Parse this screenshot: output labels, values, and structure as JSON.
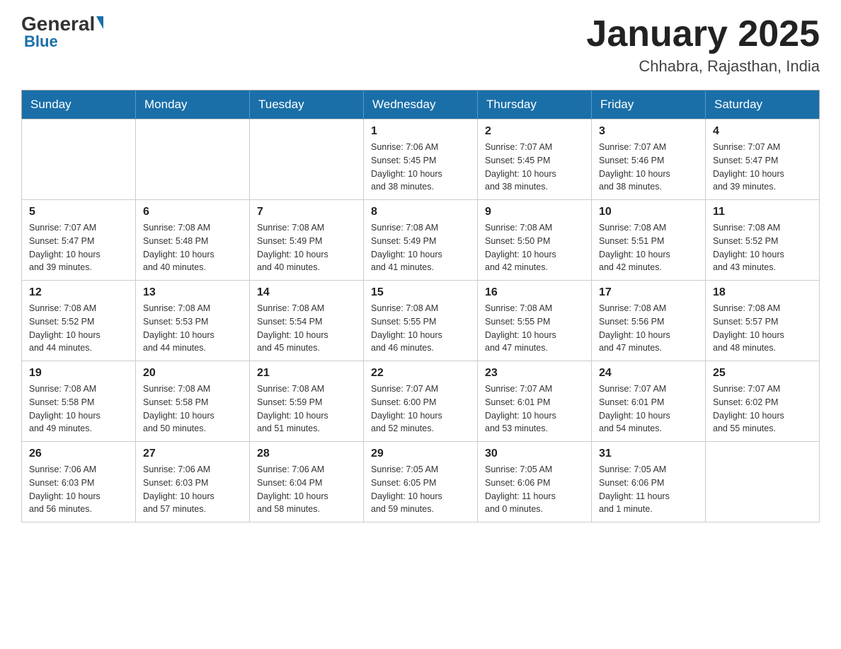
{
  "header": {
    "logo_general": "General",
    "logo_blue": "Blue",
    "title": "January 2025",
    "location": "Chhabra, Rajasthan, India"
  },
  "days_of_week": [
    "Sunday",
    "Monday",
    "Tuesday",
    "Wednesday",
    "Thursday",
    "Friday",
    "Saturday"
  ],
  "weeks": [
    [
      {
        "day": "",
        "info": ""
      },
      {
        "day": "",
        "info": ""
      },
      {
        "day": "",
        "info": ""
      },
      {
        "day": "1",
        "info": "Sunrise: 7:06 AM\nSunset: 5:45 PM\nDaylight: 10 hours\nand 38 minutes."
      },
      {
        "day": "2",
        "info": "Sunrise: 7:07 AM\nSunset: 5:45 PM\nDaylight: 10 hours\nand 38 minutes."
      },
      {
        "day": "3",
        "info": "Sunrise: 7:07 AM\nSunset: 5:46 PM\nDaylight: 10 hours\nand 38 minutes."
      },
      {
        "day": "4",
        "info": "Sunrise: 7:07 AM\nSunset: 5:47 PM\nDaylight: 10 hours\nand 39 minutes."
      }
    ],
    [
      {
        "day": "5",
        "info": "Sunrise: 7:07 AM\nSunset: 5:47 PM\nDaylight: 10 hours\nand 39 minutes."
      },
      {
        "day": "6",
        "info": "Sunrise: 7:08 AM\nSunset: 5:48 PM\nDaylight: 10 hours\nand 40 minutes."
      },
      {
        "day": "7",
        "info": "Sunrise: 7:08 AM\nSunset: 5:49 PM\nDaylight: 10 hours\nand 40 minutes."
      },
      {
        "day": "8",
        "info": "Sunrise: 7:08 AM\nSunset: 5:49 PM\nDaylight: 10 hours\nand 41 minutes."
      },
      {
        "day": "9",
        "info": "Sunrise: 7:08 AM\nSunset: 5:50 PM\nDaylight: 10 hours\nand 42 minutes."
      },
      {
        "day": "10",
        "info": "Sunrise: 7:08 AM\nSunset: 5:51 PM\nDaylight: 10 hours\nand 42 minutes."
      },
      {
        "day": "11",
        "info": "Sunrise: 7:08 AM\nSunset: 5:52 PM\nDaylight: 10 hours\nand 43 minutes."
      }
    ],
    [
      {
        "day": "12",
        "info": "Sunrise: 7:08 AM\nSunset: 5:52 PM\nDaylight: 10 hours\nand 44 minutes."
      },
      {
        "day": "13",
        "info": "Sunrise: 7:08 AM\nSunset: 5:53 PM\nDaylight: 10 hours\nand 44 minutes."
      },
      {
        "day": "14",
        "info": "Sunrise: 7:08 AM\nSunset: 5:54 PM\nDaylight: 10 hours\nand 45 minutes."
      },
      {
        "day": "15",
        "info": "Sunrise: 7:08 AM\nSunset: 5:55 PM\nDaylight: 10 hours\nand 46 minutes."
      },
      {
        "day": "16",
        "info": "Sunrise: 7:08 AM\nSunset: 5:55 PM\nDaylight: 10 hours\nand 47 minutes."
      },
      {
        "day": "17",
        "info": "Sunrise: 7:08 AM\nSunset: 5:56 PM\nDaylight: 10 hours\nand 47 minutes."
      },
      {
        "day": "18",
        "info": "Sunrise: 7:08 AM\nSunset: 5:57 PM\nDaylight: 10 hours\nand 48 minutes."
      }
    ],
    [
      {
        "day": "19",
        "info": "Sunrise: 7:08 AM\nSunset: 5:58 PM\nDaylight: 10 hours\nand 49 minutes."
      },
      {
        "day": "20",
        "info": "Sunrise: 7:08 AM\nSunset: 5:58 PM\nDaylight: 10 hours\nand 50 minutes."
      },
      {
        "day": "21",
        "info": "Sunrise: 7:08 AM\nSunset: 5:59 PM\nDaylight: 10 hours\nand 51 minutes."
      },
      {
        "day": "22",
        "info": "Sunrise: 7:07 AM\nSunset: 6:00 PM\nDaylight: 10 hours\nand 52 minutes."
      },
      {
        "day": "23",
        "info": "Sunrise: 7:07 AM\nSunset: 6:01 PM\nDaylight: 10 hours\nand 53 minutes."
      },
      {
        "day": "24",
        "info": "Sunrise: 7:07 AM\nSunset: 6:01 PM\nDaylight: 10 hours\nand 54 minutes."
      },
      {
        "day": "25",
        "info": "Sunrise: 7:07 AM\nSunset: 6:02 PM\nDaylight: 10 hours\nand 55 minutes."
      }
    ],
    [
      {
        "day": "26",
        "info": "Sunrise: 7:06 AM\nSunset: 6:03 PM\nDaylight: 10 hours\nand 56 minutes."
      },
      {
        "day": "27",
        "info": "Sunrise: 7:06 AM\nSunset: 6:03 PM\nDaylight: 10 hours\nand 57 minutes."
      },
      {
        "day": "28",
        "info": "Sunrise: 7:06 AM\nSunset: 6:04 PM\nDaylight: 10 hours\nand 58 minutes."
      },
      {
        "day": "29",
        "info": "Sunrise: 7:05 AM\nSunset: 6:05 PM\nDaylight: 10 hours\nand 59 minutes."
      },
      {
        "day": "30",
        "info": "Sunrise: 7:05 AM\nSunset: 6:06 PM\nDaylight: 11 hours\nand 0 minutes."
      },
      {
        "day": "31",
        "info": "Sunrise: 7:05 AM\nSunset: 6:06 PM\nDaylight: 11 hours\nand 1 minute."
      },
      {
        "day": "",
        "info": ""
      }
    ]
  ]
}
